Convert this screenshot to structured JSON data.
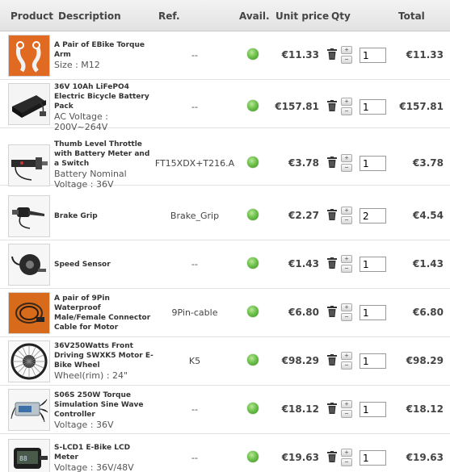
{
  "header": {
    "product": "Product",
    "description": "Description",
    "ref": "Ref.",
    "avail": "Avail.",
    "unit_price": "Unit price",
    "qty": "Qty",
    "total": "Total"
  },
  "stepper": {
    "plus": "+",
    "minus": "−"
  },
  "rows": [
    {
      "name": "A Pair of EBike Torque Arm",
      "opt1": "Size : M12",
      "opt2": "",
      "ref": "--",
      "price": "€11.33",
      "qty": "1",
      "total": "€11.33",
      "icon": "torque-arm-thumbnail"
    },
    {
      "name": "36V 10Ah LiFePO4 Electric Bicycle Battery Pack",
      "opt1": "AC Voltage :",
      "opt2": "200V~264V",
      "ref": "--",
      "price": "€157.81",
      "qty": "1",
      "total": "€157.81",
      "icon": "battery-pack-thumbnail"
    },
    {
      "name": "Thumb Level Throttle with Battery Meter and a Switch",
      "opt1": "Battery Nominal",
      "opt2": "Voltage : 36V",
      "ref": "FT15XDX+T216.A",
      "price": "€3.78",
      "qty": "1",
      "total": "€3.78",
      "icon": "throttle-thumbnail"
    },
    {
      "name": "Brake Grip",
      "opt1": "",
      "opt2": "",
      "ref": "Brake_Grip",
      "price": "€2.27",
      "qty": "2",
      "total": "€4.54",
      "icon": "brake-grip-thumbnail"
    },
    {
      "name": "Speed Sensor",
      "opt1": "",
      "opt2": "",
      "ref": "--",
      "price": "€1.43",
      "qty": "1",
      "total": "€1.43",
      "icon": "speed-sensor-thumbnail"
    },
    {
      "name": "A pair of 9Pin Waterproof Male/Female Connector Cable for Motor",
      "opt1": "",
      "opt2": "",
      "ref": "9Pin-cable",
      "price": "€6.80",
      "qty": "1",
      "total": "€6.80",
      "icon": "connector-cable-thumbnail"
    },
    {
      "name": "36V250Watts Front Driving SWXK5 Motor E-Bike Wheel",
      "opt1": "Wheel(rim) : 24\"",
      "opt2": "",
      "ref": "K5",
      "price": "€98.29",
      "qty": "1",
      "total": "€98.29",
      "icon": "motor-wheel-thumbnail"
    },
    {
      "name": "S06S 250W Torque Simulation Sine Wave Controller",
      "opt1": "Voltage : 36V",
      "opt2": "",
      "ref": "--",
      "price": "€18.12",
      "qty": "1",
      "total": "€18.12",
      "icon": "controller-thumbnail"
    },
    {
      "name": "S-LCD1 E-Bike LCD Meter",
      "opt1": "Voltage : 36V/48V",
      "opt2": "",
      "ref": "--",
      "price": "€19.63",
      "qty": "1",
      "total": "€19.63",
      "icon": "lcd-meter-thumbnail"
    }
  ]
}
